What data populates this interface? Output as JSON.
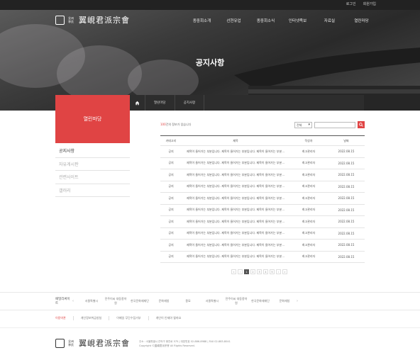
{
  "header": {
    "top_links": [
      "로그인",
      "회원가입"
    ],
    "logo_main": "翼峴君派宗會",
    "logo_sub": "全州李氏",
    "nav": [
      "종중회소개",
      "선현유업",
      "종중회소식",
      "인터넷족보",
      "자료실",
      "열린마당"
    ]
  },
  "hero": {
    "title": "공지사항"
  },
  "breadcrumb": [
    "열린마당",
    "공지사항"
  ],
  "sidebar": {
    "title": "열린마당",
    "items": [
      {
        "label": "공지사항",
        "active": true
      },
      {
        "label": "자유게시판",
        "active": false
      },
      {
        "label": "관련사이트",
        "active": false
      },
      {
        "label": "갤러리",
        "active": false
      }
    ]
  },
  "board": {
    "total_prefix": "100",
    "total_suffix": "건의 정보가 있습니다",
    "select_value": "전체",
    "columns": [
      "카테고리",
      "제목",
      "작성자",
      "날짜"
    ],
    "rows": [
      {
        "cat": "공지",
        "title": "제목이 들어가는 부분입니다. 제목이 들어가는 부분입니다. 제목이 들어가는 부분...",
        "author": "최고관리자",
        "date": "2022.08.15"
      },
      {
        "cat": "공지",
        "title": "제목이 들어가는 부분입니다. 제목이 들어가는 부분입니다. 제목이 들어가는 부분...",
        "author": "최고관리자",
        "date": "2022.08.15"
      },
      {
        "cat": "공지",
        "title": "제목이 들어가는 부분입니다. 제목이 들어가는 부분입니다. 제목이 들어가는 부분...",
        "author": "최고관리자",
        "date": "2022.08.15"
      },
      {
        "cat": "공지",
        "title": "제목이 들어가는 부분입니다. 제목이 들어가는 부분입니다. 제목이 들어가는 부분...",
        "author": "최고관리자",
        "date": "2022.08.15"
      },
      {
        "cat": "공지",
        "title": "제목이 들어가는 부분입니다. 제목이 들어가는 부분입니다. 제목이 들어가는 부분...",
        "author": "최고관리자",
        "date": "2022.08.15"
      },
      {
        "cat": "공지",
        "title": "제목이 들어가는 부분입니다. 제목이 들어가는 부분입니다. 제목이 들어가는 부분...",
        "author": "최고관리자",
        "date": "2022.08.15"
      },
      {
        "cat": "공지",
        "title": "제목이 들어가는 부분입니다. 제목이 들어가는 부분입니다. 제목이 들어가는 부분...",
        "author": "최고관리자",
        "date": "2022.08.15"
      },
      {
        "cat": "공지",
        "title": "제목이 들어가는 부분입니다. 제목이 들어가는 부분입니다. 제목이 들어가는 부분...",
        "author": "최고관리자",
        "date": "2022.08.15"
      },
      {
        "cat": "공지",
        "title": "제목이 들어가는 부분입니다. 제목이 들어가는 부분입니다. 제목이 들어가는 부분...",
        "author": "최고관리자",
        "date": "2022.08.15"
      },
      {
        "cat": "공지",
        "title": "제목이 들어가는 부분입니다. 제목이 들어가는 부분입니다. 제목이 들어가는 부분...",
        "author": "최고관리자",
        "date": "2022.08.15"
      }
    ]
  },
  "pagination": {
    "prev_first": "«",
    "prev": "‹",
    "pages": [
      "1",
      "2",
      "3",
      "4",
      "5"
    ],
    "current": "1",
    "next": "›",
    "next_last": "»"
  },
  "partners": {
    "label": "패밀리싸이트",
    "logos": [
      "서울특별시",
      "전주이씨 대동종약원",
      "한국문화재재단",
      "문화재청",
      "종묘",
      "서울특별시",
      "전주이씨 대동종약원",
      "한국문화재재단",
      "문화재청"
    ]
  },
  "footer": {
    "links": [
      "이용약관",
      "개인정보취급방침",
      "이메일 무단수집거부",
      "개인이 인제야 될까요"
    ],
    "address_lines": [
      "주소 : 서울특별시 관악구 봉천로 575 | 대표번호 02-886-8988 | FAX 02-883-8041",
      "Copyright ©翼峴君派宗會 All Rights Reserved."
    ]
  },
  "colors": {
    "accent": "#e04444",
    "dark": "#2d2d2d"
  }
}
